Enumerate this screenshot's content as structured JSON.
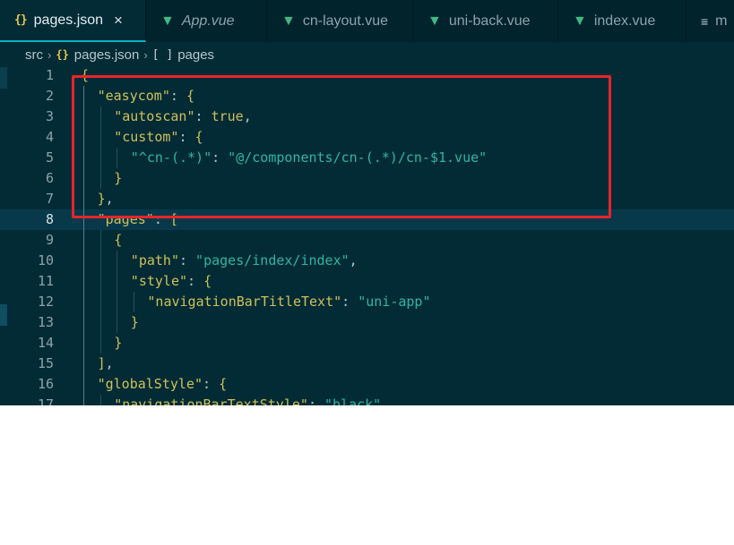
{
  "tabs": [
    {
      "label": "pages.json",
      "icon": "json-icon",
      "glyph": "{}",
      "active": true,
      "italic": false,
      "close": "×"
    },
    {
      "label": "App.vue",
      "icon": "vue-icon",
      "glyph": "▼",
      "active": false,
      "italic": true
    },
    {
      "label": "cn-layout.vue",
      "icon": "vue-icon",
      "glyph": "▼",
      "active": false,
      "italic": false
    },
    {
      "label": "uni-back.vue",
      "icon": "vue-icon",
      "glyph": "▼",
      "active": false,
      "italic": false
    },
    {
      "label": "index.vue",
      "icon": "vue-icon",
      "glyph": "▼",
      "active": false,
      "italic": false
    },
    {
      "label": "m",
      "icon": "menu-icon",
      "glyph": "≡",
      "active": false,
      "italic": false
    }
  ],
  "breadcrumb": {
    "folder": "src",
    "file": "pages.json",
    "file_glyph": "{}",
    "node_glyph": "[ ]",
    "node": "pages",
    "separator": "›"
  },
  "editor": {
    "current_line": 8,
    "lines": [
      {
        "n": "1",
        "indent": 0,
        "tokens": [
          {
            "c": "b",
            "t": "{"
          }
        ]
      },
      {
        "n": "2",
        "indent": 1,
        "tokens": [
          {
            "c": "k",
            "t": "\"easycom\""
          },
          {
            "c": "p",
            "t": ": "
          },
          {
            "c": "b",
            "t": "{"
          }
        ]
      },
      {
        "n": "3",
        "indent": 2,
        "tokens": [
          {
            "c": "k",
            "t": "\"autoscan\""
          },
          {
            "c": "p",
            "t": ": "
          },
          {
            "c": "k",
            "t": "true"
          },
          {
            "c": "p",
            "t": ","
          }
        ]
      },
      {
        "n": "4",
        "indent": 2,
        "tokens": [
          {
            "c": "k",
            "t": "\"custom\""
          },
          {
            "c": "p",
            "t": ": "
          },
          {
            "c": "b",
            "t": "{"
          }
        ]
      },
      {
        "n": "5",
        "indent": 3,
        "tokens": [
          {
            "c": "s",
            "t": "\"^cn-(.*)\""
          },
          {
            "c": "p",
            "t": ": "
          },
          {
            "c": "s",
            "t": "\"@/components/cn-(.*)/cn-$1.vue\""
          }
        ]
      },
      {
        "n": "6",
        "indent": 2,
        "tokens": [
          {
            "c": "b",
            "t": "}"
          }
        ]
      },
      {
        "n": "7",
        "indent": 1,
        "tokens": [
          {
            "c": "b",
            "t": "}"
          },
          {
            "c": "p",
            "t": ","
          }
        ]
      },
      {
        "n": "8",
        "indent": 1,
        "tokens": [
          {
            "c": "k",
            "t": "\"pages\""
          },
          {
            "c": "p",
            "t": ": "
          },
          {
            "c": "b",
            "t": "["
          }
        ]
      },
      {
        "n": "9",
        "indent": 2,
        "tokens": [
          {
            "c": "b",
            "t": "{"
          }
        ]
      },
      {
        "n": "10",
        "indent": 3,
        "tokens": [
          {
            "c": "k",
            "t": "\"path\""
          },
          {
            "c": "p",
            "t": ": "
          },
          {
            "c": "s",
            "t": "\"pages/index/index\""
          },
          {
            "c": "p",
            "t": ","
          }
        ]
      },
      {
        "n": "11",
        "indent": 3,
        "tokens": [
          {
            "c": "k",
            "t": "\"style\""
          },
          {
            "c": "p",
            "t": ": "
          },
          {
            "c": "b",
            "t": "{"
          }
        ]
      },
      {
        "n": "12",
        "indent": 4,
        "tokens": [
          {
            "c": "k",
            "t": "\"navigationBarTitleText\""
          },
          {
            "c": "p",
            "t": ": "
          },
          {
            "c": "s",
            "t": "\"uni-app\""
          }
        ]
      },
      {
        "n": "13",
        "indent": 3,
        "tokens": [
          {
            "c": "b",
            "t": "}"
          }
        ]
      },
      {
        "n": "14",
        "indent": 2,
        "tokens": [
          {
            "c": "b",
            "t": "}"
          }
        ]
      },
      {
        "n": "15",
        "indent": 1,
        "tokens": [
          {
            "c": "b",
            "t": "]"
          },
          {
            "c": "p",
            "t": ","
          }
        ]
      },
      {
        "n": "16",
        "indent": 1,
        "tokens": [
          {
            "c": "k",
            "t": "\"globalStyle\""
          },
          {
            "c": "p",
            "t": ": "
          },
          {
            "c": "b",
            "t": "{"
          }
        ]
      },
      {
        "n": "17",
        "indent": 2,
        "tokens": [
          {
            "c": "k",
            "t": "\"navigationBarTextStyle\""
          },
          {
            "c": "p",
            "t": ": "
          },
          {
            "c": "s",
            "t": "\"black\""
          },
          {
            "c": "p",
            "t": ","
          }
        ]
      }
    ]
  },
  "colors": {
    "highlight_box": "#e6252b",
    "editor_bg": "#022b36",
    "key": "#cfc05a",
    "string": "#2fb5a6"
  }
}
